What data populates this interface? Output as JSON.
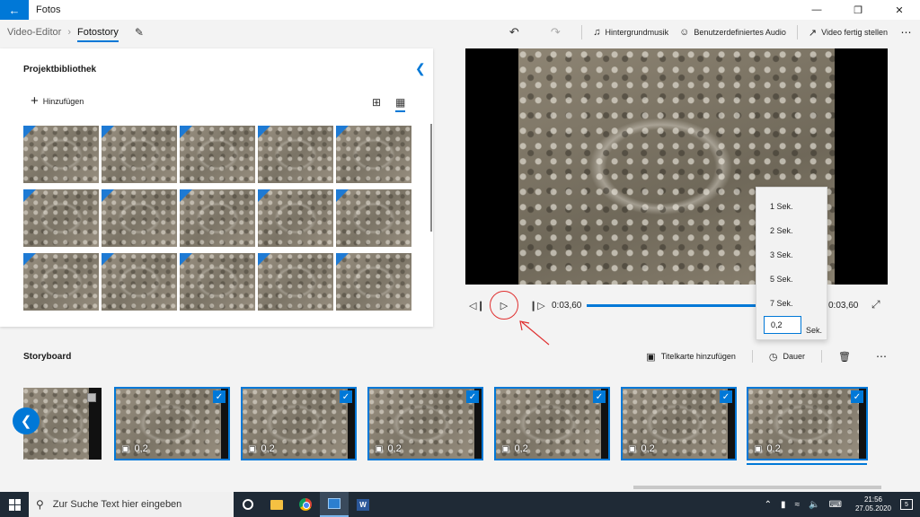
{
  "window": {
    "title": "Fotos",
    "back_icon": "arrow-left-icon"
  },
  "breadcrumb": {
    "parent": "Video-Editor",
    "current": "Fotostory"
  },
  "toolbar": {
    "background_music": "Hintergrundmusik",
    "custom_audio": "Benutzerdefiniertes Audio",
    "finish_video": "Video fertig stellen"
  },
  "library": {
    "title": "Projektbibliothek",
    "add_label": "Hinzufügen"
  },
  "playback": {
    "current_time": "0:03,60",
    "end_time": "0:03,60"
  },
  "duration_menu": {
    "options": [
      "1 Sek.",
      "2 Sek.",
      "3 Sek.",
      "5 Sek.",
      "7 Sek."
    ],
    "custom_value": "0,2",
    "unit": "Sek."
  },
  "storyboard": {
    "title": "Storyboard",
    "add_title_card": "Titelkarte hinzufügen",
    "duration_label": "Dauer",
    "clips": [
      {
        "duration": "0,2"
      },
      {
        "duration": "0,2"
      },
      {
        "duration": "0,2"
      },
      {
        "duration": "0,2"
      },
      {
        "duration": "0,2"
      },
      {
        "duration": "0,2"
      }
    ]
  },
  "taskbar": {
    "search_placeholder": "Zur Suche Text hier eingeben",
    "time": "21:56",
    "date": "27.05.2020",
    "notification_count": "5"
  },
  "colors": {
    "accent": "#0078d7",
    "annotation": "#e03030",
    "taskbar": "#1f2a36"
  }
}
